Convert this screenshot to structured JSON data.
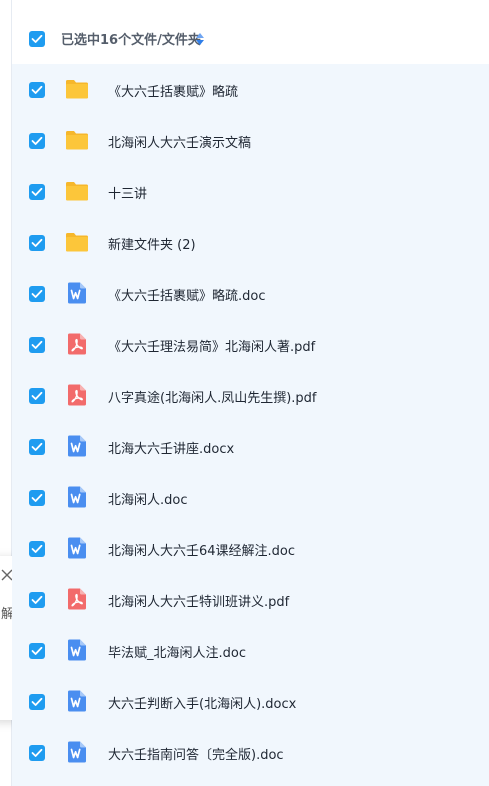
{
  "header": {
    "selection_label": "已选中16个文件/文件夹"
  },
  "popup": {
    "text": "解"
  },
  "files": [
    {
      "name": "《大六壬括裹赋》略疏",
      "type": "folder"
    },
    {
      "name": "北海闲人大六壬演示文稿",
      "type": "folder"
    },
    {
      "name": "十三讲",
      "type": "folder"
    },
    {
      "name": "新建文件夹 (2)",
      "type": "folder"
    },
    {
      "name": "《大六壬括裹赋》略疏.doc",
      "type": "word"
    },
    {
      "name": "《大六壬理法易简》北海闲人著.pdf",
      "type": "pdf"
    },
    {
      "name": "八字真途(北海闲人.凤山先生撰).pdf",
      "type": "pdf"
    },
    {
      "name": "北海大六壬讲座.docx",
      "type": "word"
    },
    {
      "name": "北海闲人.doc",
      "type": "word"
    },
    {
      "name": "北海闲人大六壬64课经解注.doc",
      "type": "word"
    },
    {
      "name": "北海闲人大六壬特训班讲义.pdf",
      "type": "pdf"
    },
    {
      "name": "毕法赋_北海闲人注.doc",
      "type": "word"
    },
    {
      "name": "大六壬判断入手(北海闲人).docx",
      "type": "word"
    },
    {
      "name": "大六壬指南问答〔完全版).doc",
      "type": "word"
    }
  ],
  "colors": {
    "accent": "#1f9cf0",
    "folder": "#fcc63a",
    "word": "#4a8ef0",
    "pdf": "#f26b6b",
    "list_bg": "#f1f7fd"
  },
  "icons": {
    "folder": "folder-icon",
    "word": "word-doc-icon",
    "pdf": "pdf-icon",
    "checkbox": "checkbox-checked-icon",
    "sort": "sort-icon",
    "close": "close-icon"
  }
}
